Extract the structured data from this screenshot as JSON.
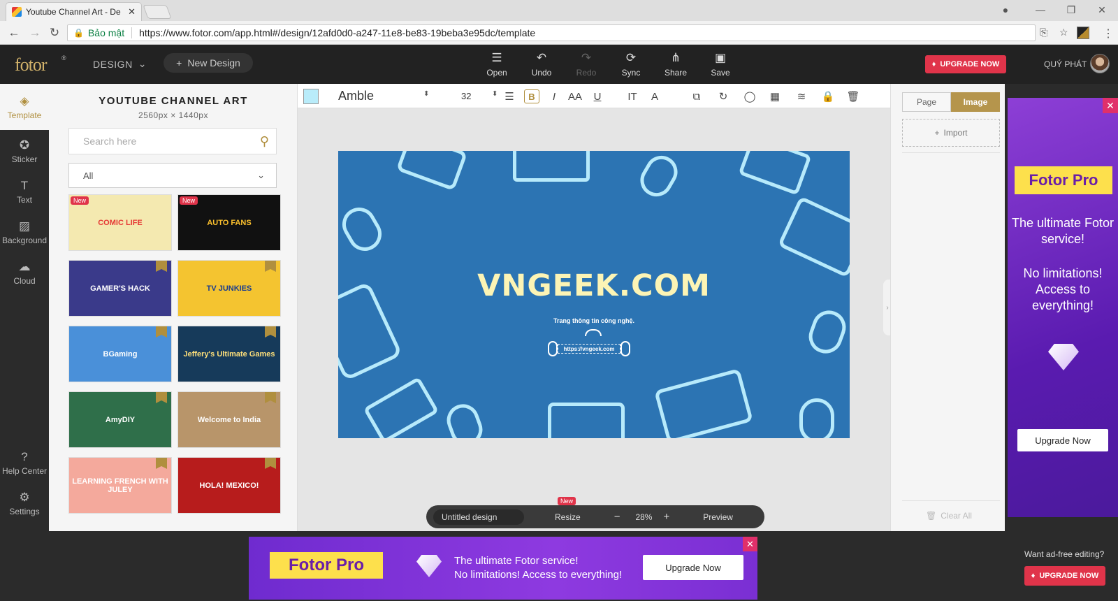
{
  "browser": {
    "tab_title": "Youtube Channel Art - De",
    "tab_close": "✕",
    "secure_label": "Bảo mật",
    "url": "https://www.fotor.com/app.html#/design/12afd0d0-a247-11e8-be83-19beba3e95dc/template"
  },
  "header": {
    "logo": "fotor",
    "logo_mark": "®",
    "design_menu": "DESIGN",
    "new_design": "New Design",
    "tools": [
      {
        "label": "Open",
        "icon": "menu-icon",
        "glyph": "☰"
      },
      {
        "label": "Undo",
        "icon": "undo-icon",
        "glyph": "↶"
      },
      {
        "label": "Redo",
        "icon": "redo-icon",
        "glyph": "↷"
      },
      {
        "label": "Sync",
        "icon": "sync-icon",
        "glyph": "⟳"
      },
      {
        "label": "Share",
        "icon": "share-icon",
        "glyph": "⋔"
      },
      {
        "label": "Save",
        "icon": "save-icon",
        "glyph": "▣"
      }
    ],
    "upgrade": "UPGRADE NOW",
    "username": "QUÝ PHÁT"
  },
  "rail": {
    "items": [
      {
        "label": "Template",
        "glyph": "◈"
      },
      {
        "label": "Sticker",
        "glyph": "✪"
      },
      {
        "label": "Text",
        "glyph": "T"
      },
      {
        "label": "Background",
        "glyph": "▨"
      },
      {
        "label": "Cloud",
        "glyph": "☁"
      },
      {
        "label": "Help Center",
        "glyph": "?"
      },
      {
        "label": "Settings",
        "glyph": "⚙"
      }
    ]
  },
  "template_panel": {
    "title": "YOUTUBE CHANNEL ART",
    "size": "2560px × 1440px",
    "search_placeholder": "Search here",
    "filter": "All",
    "new_badge": "New",
    "thumbnails": [
      {
        "text": "COMIC LIFE",
        "bg": "#f4e9b0",
        "fg": "#e53935",
        "badge": "new"
      },
      {
        "text": "AUTO FANS",
        "bg": "#111111",
        "fg": "#fbc02d",
        "badge": "new"
      },
      {
        "text": "GAMER'S HACK",
        "bg": "#3a3a8a",
        "fg": "#ffffff",
        "badge": "pro"
      },
      {
        "text": "TV JUNKIES",
        "bg": "#f4c430",
        "fg": "#1a3d8f",
        "badge": "pro"
      },
      {
        "text": "BGaming",
        "bg": "#4a90d9",
        "fg": "#ffffff",
        "badge": "pro"
      },
      {
        "text": "Jeffery's Ultimate Games",
        "bg": "#163a5a",
        "fg": "#ffe07a",
        "badge": "pro"
      },
      {
        "text": "AmyDIY",
        "bg": "#2f6f4a",
        "fg": "#ffffff",
        "badge": "pro"
      },
      {
        "text": "Welcome to India",
        "bg": "#b8956a",
        "fg": "#ffffff",
        "badge": "pro"
      },
      {
        "text": "LEARNING FRENCH WITH JULEY",
        "bg": "#f4a99c",
        "fg": "#ffffff",
        "badge": "pro"
      },
      {
        "text": "HOLA! MEXICO!",
        "bg": "#b71c1c",
        "fg": "#ffffff",
        "badge": "pro"
      }
    ]
  },
  "text_toolbar": {
    "font_family": "Amble",
    "font_size": "32",
    "color": "#b9ecfa",
    "tools": [
      {
        "name": "align-icon",
        "glyph": "☰"
      },
      {
        "name": "bold-button",
        "glyph": "B"
      },
      {
        "name": "italic-button",
        "glyph": "I"
      },
      {
        "name": "font-case-button",
        "glyph": "AA"
      },
      {
        "name": "underline-button",
        "glyph": "U"
      },
      {
        "name": "line-height-icon",
        "glyph": "IT"
      },
      {
        "name": "text-effect-icon",
        "glyph": "A"
      },
      {
        "name": "duplicate-icon",
        "glyph": "⧉"
      },
      {
        "name": "rotate-icon",
        "glyph": "↻"
      },
      {
        "name": "shape-icon",
        "glyph": "◯"
      },
      {
        "name": "transparency-icon",
        "glyph": "▦"
      },
      {
        "name": "layers-icon",
        "glyph": "≋"
      },
      {
        "name": "lock-icon",
        "glyph": "🔒"
      },
      {
        "name": "delete-icon",
        "glyph": "🗑"
      }
    ]
  },
  "canvas": {
    "bg": "#2c74b3",
    "title": "VNGEEK.COM",
    "subtitle": "Trang thông tin công nghệ.",
    "url": "https://vngeek.com"
  },
  "bottom_bar": {
    "design_name": "Untitled design",
    "resize": "Resize",
    "new_badge": "New",
    "zoom_out": "−",
    "zoom": "28%",
    "zoom_in": "+",
    "preview": "Preview"
  },
  "right_panel": {
    "tab_page": "Page",
    "tab_image": "Image",
    "import": "Import",
    "clear_all": "Clear All"
  },
  "ad_right": {
    "brand": "Fotor Pro",
    "line1": "The ultimate Fotor service!",
    "line2": "No limitations! Access to everything!",
    "button": "Upgrade Now"
  },
  "ad_bottom": {
    "brand": "Fotor Pro",
    "line1": "The ultimate Fotor service!",
    "line2": "No limitations! Access to everything!",
    "button": "Upgrade Now"
  },
  "footer": {
    "adfree": "Want ad-free editing?",
    "upgrade": "UPGRADE NOW"
  }
}
